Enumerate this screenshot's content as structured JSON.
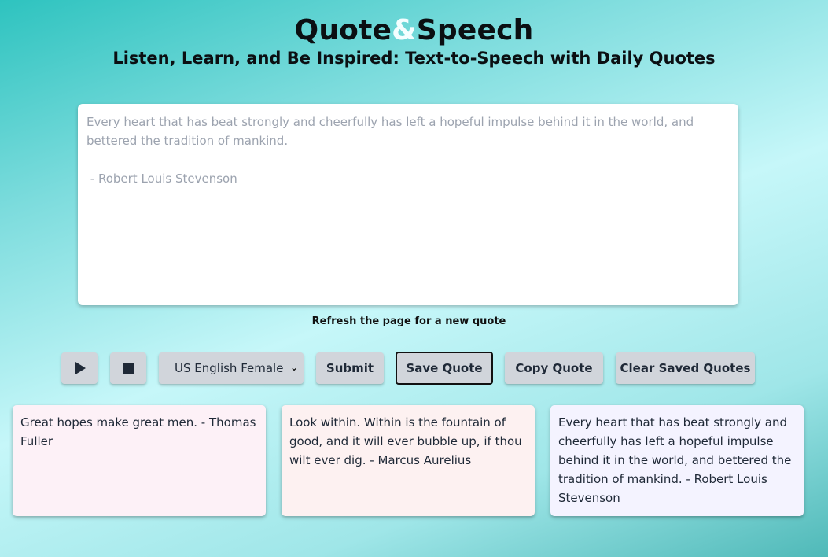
{
  "header": {
    "title_part1": "Quote",
    "title_amp": "&",
    "title_part2": "Speech",
    "subtitle": "Listen, Learn, and Be Inspired: Text-to-Speech with Daily Quotes"
  },
  "quote_area": {
    "text": "Every heart that has beat strongly and cheerfully has left a hopeful impulse behind it in the world, and bettered the tradition of mankind.\n\n - Robert Louis Stevenson"
  },
  "refresh_hint": "Refresh the page for a new quote",
  "controls": {
    "play_icon": "play-icon",
    "stop_icon": "stop-icon",
    "voice_selected": "US English Female",
    "submit_label": "Submit",
    "save_label": "Save Quote",
    "copy_label": "Copy Quote",
    "clear_label": "Clear Saved Quotes"
  },
  "saved_quotes": [
    {
      "text": "Great hopes make great men. - Thomas Fuller",
      "color": "#fdf1f7"
    },
    {
      "text": "Look within. Within is the fountain of good, and it will ever bubble up, if thou wilt ever dig. - Marcus Aurelius",
      "color": "#fdf1f1"
    },
    {
      "text": "Every heart that has beat strongly and cheerfully has left a hopeful impulse behind it in the world, and bettered the tradition of mankind. - Robert Louis Stevenson",
      "color": "#f4f3ff"
    }
  ],
  "colors": {
    "accent_amp": "#f4feff",
    "button_bg": "#d1d5db",
    "text_dark": "#1f2937"
  }
}
